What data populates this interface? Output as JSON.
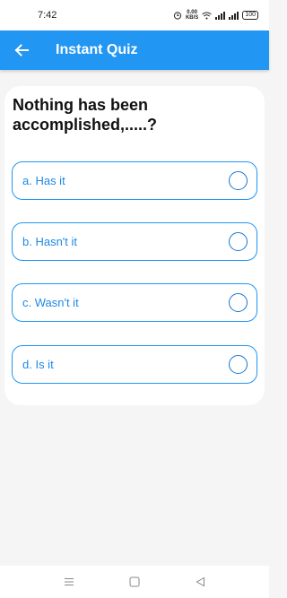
{
  "status_bar": {
    "time": "7:42",
    "net_speed_value": "0.00",
    "net_speed_unit": "KB/S",
    "battery": "100"
  },
  "app_bar": {
    "title": "Instant Quiz",
    "back_icon": "arrow-left-icon",
    "background": "#2196f3"
  },
  "quiz": {
    "question": "Nothing has been accomplished,.....?",
    "options": [
      {
        "label": "a. Has it",
        "selected": false
      },
      {
        "label": "b. Hasn't it",
        "selected": false
      },
      {
        "label": "c. Wasn't it",
        "selected": false
      },
      {
        "label": "d. Is it",
        "selected": false
      }
    ],
    "accent_color": "#2196f3"
  },
  "nav_bar": {
    "buttons": [
      "menu-icon",
      "home-square-icon",
      "back-triangle-icon"
    ]
  }
}
